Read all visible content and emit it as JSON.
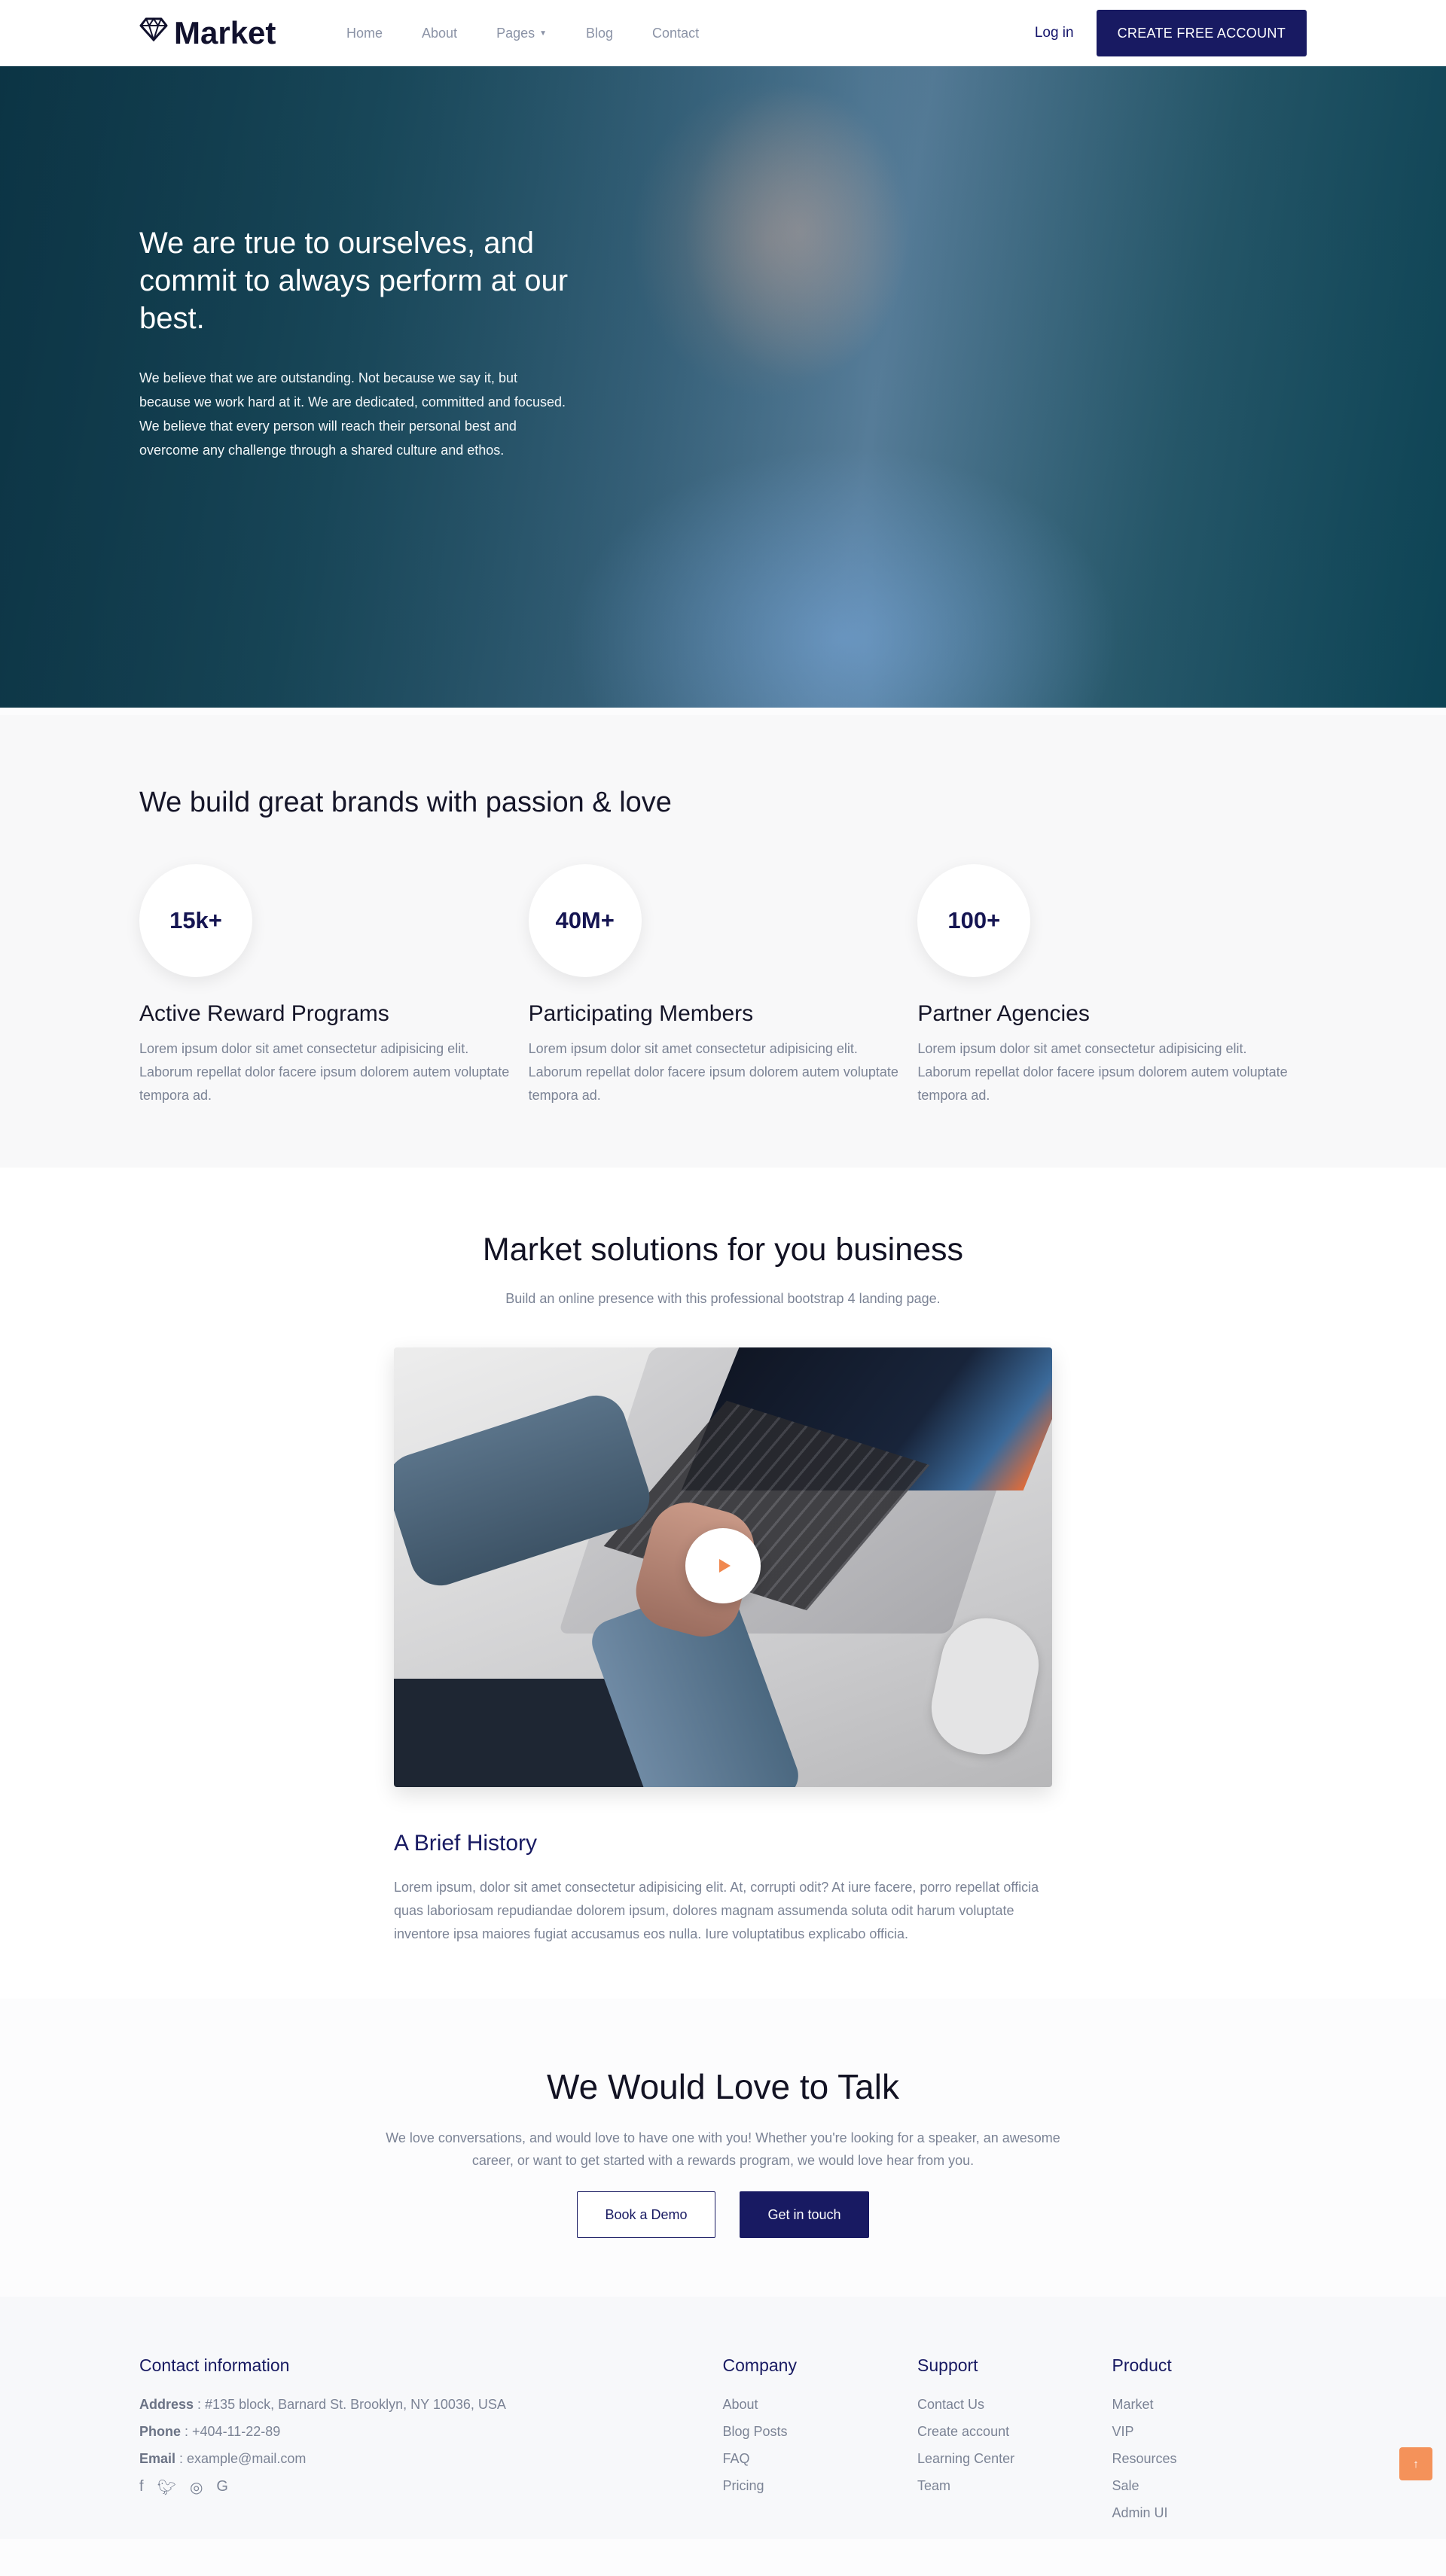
{
  "nav": {
    "logo": "Market",
    "items": [
      {
        "label": "Home"
      },
      {
        "label": "About"
      },
      {
        "label": "Pages"
      },
      {
        "label": "Blog"
      },
      {
        "label": "Contact"
      }
    ],
    "login": "Log in",
    "cta": "CREATE FREE ACCOUNT"
  },
  "hero": {
    "title": "We are true to ourselves, and commit to always perform at our best.",
    "text": "We believe that we are outstanding. Not because we say it, but because we work hard at it. We are dedicated, committed and focused. We believe that every person will reach their personal best and overcome any challenge through a shared culture and ethos."
  },
  "stats": {
    "title": "We build great brands with passion & love",
    "items": [
      {
        "value": "15k+",
        "label": "Active Reward Programs",
        "text": "Lorem ipsum dolor sit amet consectetur adipisicing elit. Laborum repellat dolor facere ipsum dolorem autem voluptate tempora ad."
      },
      {
        "value": "40M+",
        "label": "Participating Members",
        "text": "Lorem ipsum dolor sit amet consectetur adipisicing elit. Laborum repellat dolor facere ipsum dolorem autem voluptate tempora ad."
      },
      {
        "value": "100+",
        "label": "Partner Agencies",
        "text": "Lorem ipsum dolor sit amet consectetur adipisicing elit. Laborum repellat dolor facere ipsum dolorem autem voluptate tempora ad."
      }
    ]
  },
  "solutions": {
    "title": "Market solutions for you business",
    "subtitle": "Build an online presence with this professional bootstrap 4 landing page.",
    "history_title": "A Brief History",
    "history_text": "Lorem ipsum, dolor sit amet consectetur adipisicing elit. At, corrupti odit? At iure facere, porro repellat officia quas laboriosam repudiandae dolorem ipsum, dolores magnam assumenda soluta odit harum voluptate inventore ipsa maiores fugiat accusamus eos nulla. Iure voluptatibus explicabo officia."
  },
  "talk": {
    "title": "We Would Love to Talk",
    "text": "We love conversations, and would love to have one with you! Whether you're looking for a speaker, an awesome career, or want to get started with a rewards program, we would love hear from you.",
    "demo": "Book a Demo",
    "touch": "Get in touch"
  },
  "footer": {
    "contact_title": "Contact information",
    "address_label": "Address",
    "address": " : #135 block, Barnard St. Brooklyn, NY 10036, USA",
    "phone_label": "Phone",
    "phone": " : +404-11-22-89",
    "email_label": "Email",
    "email": " : example@mail.com",
    "company": {
      "title": "Company",
      "links": [
        "About",
        "Blog Posts",
        "FAQ",
        "Pricing"
      ]
    },
    "support": {
      "title": "Support",
      "links": [
        "Contact Us",
        "Create account",
        "Learning Center",
        "Team"
      ]
    },
    "product": {
      "title": "Product",
      "links": [
        "Market",
        "VIP",
        "Resources",
        "Sale",
        "Admin UI"
      ]
    }
  },
  "colors": {
    "primary": "#181a62",
    "accent": "#f4925a",
    "muted": "#7b8395"
  }
}
